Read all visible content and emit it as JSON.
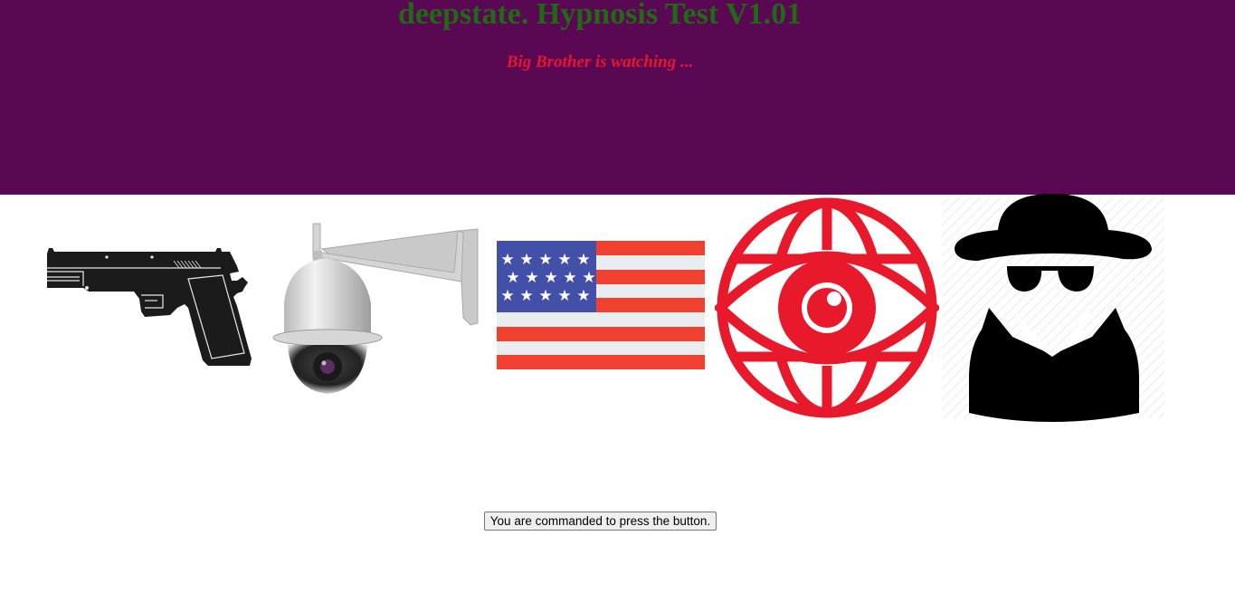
{
  "header": {
    "title": "deepstate. Hypnosis Test V1.01",
    "subtitle": "Big Brother is watching ...",
    "background": "#5a0754",
    "title_color": "#1e6b13",
    "subtitle_color": "#e4182c"
  },
  "images": [
    {
      "icon": "pistol-icon"
    },
    {
      "icon": "security-camera-icon"
    },
    {
      "icon": "us-flag-icon"
    },
    {
      "icon": "all-seeing-eye-globe-icon"
    },
    {
      "icon": "spy-agent-icon"
    }
  ],
  "button": {
    "label": "You are commanded to press the button."
  }
}
